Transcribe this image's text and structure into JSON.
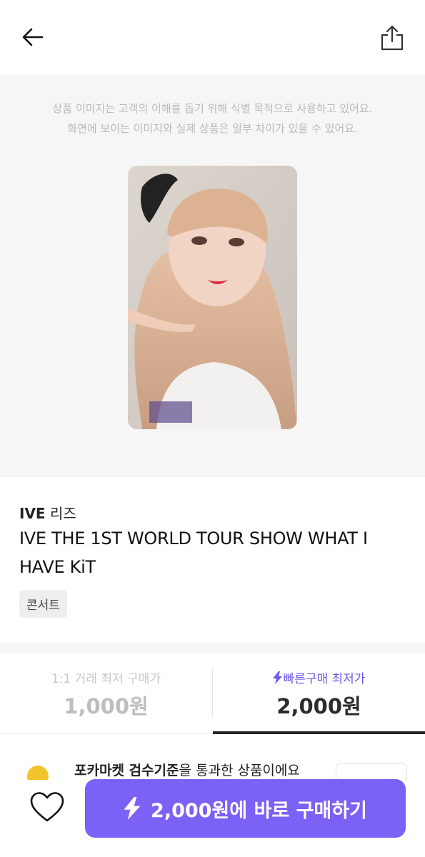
{
  "header": {
    "back_icon": "arrow-left-icon",
    "share_icon": "share-icon"
  },
  "image_section": {
    "disclaimer_line1": "상품 이미지는 고객의 이해를 돕기 위해 식별 목적으로 사용하고 있어요.",
    "disclaimer_line2": "화면에 보이는 이미지와 실제 상품은 일부 차이가 있을 수 있어요."
  },
  "product": {
    "group": "IVE",
    "member": "리즈",
    "title": "IVE THE 1ST WORLD TOUR SHOW WHAT I HAVE KiT",
    "tag": "콘서트"
  },
  "prices": {
    "direct": {
      "label": "1:1 거래 최저 구매가",
      "value": "1,000원"
    },
    "quick": {
      "label": "빠른구매 최저가",
      "value": "2,000원",
      "icon": "lightning-icon"
    }
  },
  "notice": {
    "brand": "포카마켓 검수기준",
    "rest": "을 통과한 상품이에요"
  },
  "bottom": {
    "heart_icon": "heart-icon",
    "buy_label": "2,000원에 바로 구매하기",
    "buy_icon": "lightning-icon"
  },
  "colors": {
    "accent": "#7b61f5",
    "accent_text": "#6d55e6",
    "badge": "#f3c32b"
  }
}
